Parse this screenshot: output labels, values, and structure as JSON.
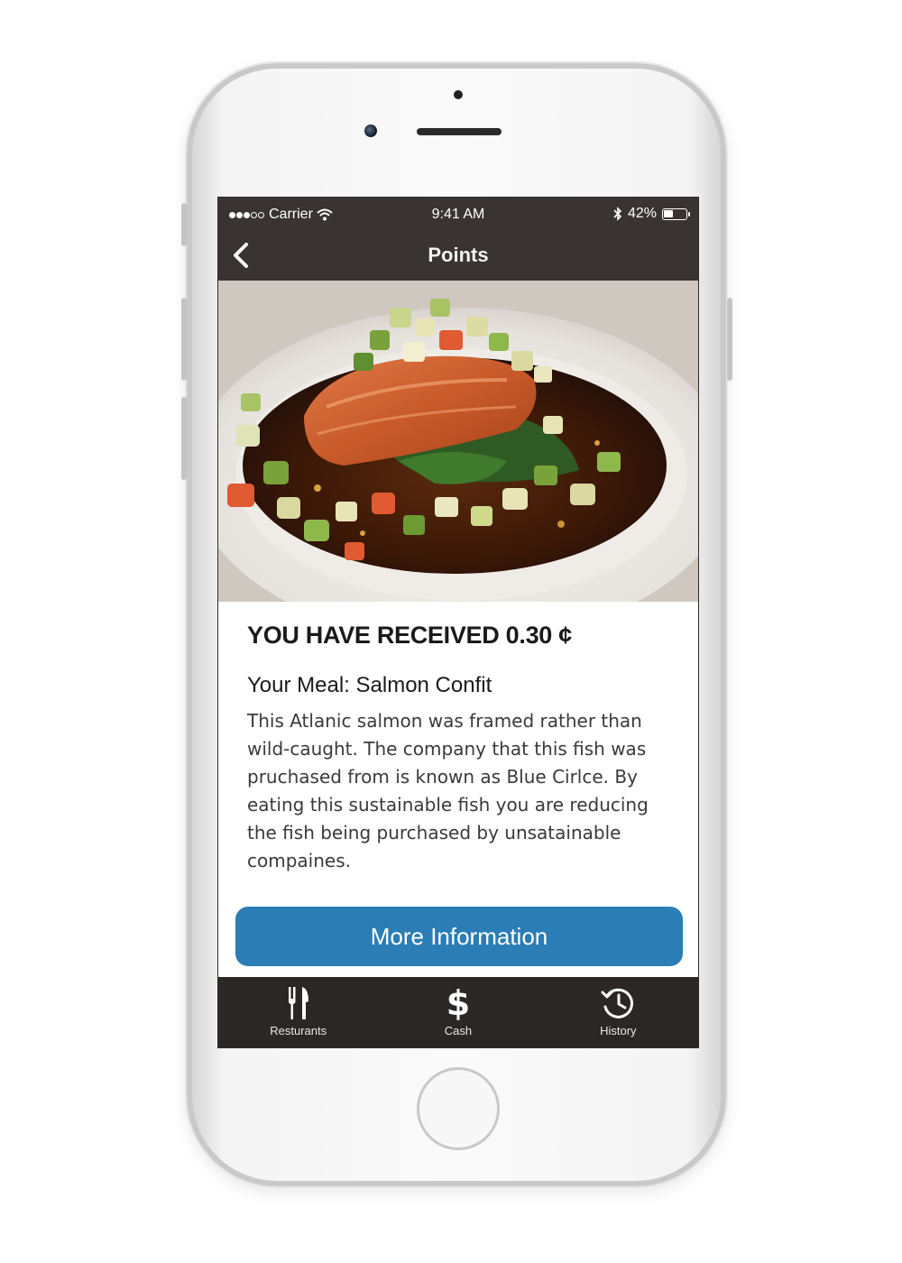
{
  "status_bar": {
    "signal_full": 3,
    "signal_empty": 2,
    "carrier": "Carrier",
    "time": "9:41 AM",
    "battery": "42%",
    "battery_level": 0.42
  },
  "nav": {
    "title": "Points",
    "back_icon": "chevron-left-icon"
  },
  "hero_image": {
    "subject": "salmon-dish-photo"
  },
  "content": {
    "headline": "YOU HAVE RECEIVED 0.30 ¢",
    "meal_title": "Your Meal: Salmon Confit",
    "description": "This Atlanic salmon was framed rather than wild-caught. The company that this fish was pruchased from is known as Blue Cirlce. By eating this sustainable fish you are reducing the fish being purchased by unsatainable compaines."
  },
  "actions": {
    "more_info_label": "More Information"
  },
  "tabbar": {
    "items": [
      {
        "label": "Resturants",
        "icon": "fork-knife-icon"
      },
      {
        "label": "Cash",
        "icon": "dollar-icon",
        "glyph": "$"
      },
      {
        "label": "History",
        "icon": "history-clock-icon"
      }
    ]
  },
  "colors": {
    "bar_bg": "#393431",
    "tabbar_bg": "#2b2724",
    "button_blue": "#2a7db5"
  }
}
